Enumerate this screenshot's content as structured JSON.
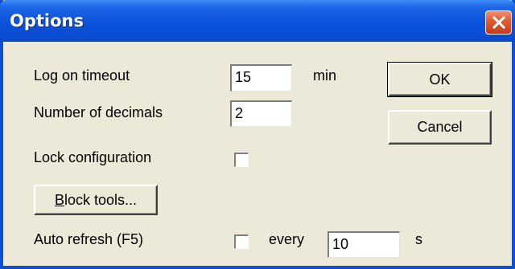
{
  "window": {
    "title": "Options"
  },
  "fields": {
    "log_on_timeout": {
      "label": "Log on timeout",
      "value": "15",
      "unit": "min"
    },
    "number_of_decimals": {
      "label": "Number of decimals",
      "value": "2"
    },
    "lock_configuration": {
      "label": "Lock configuration",
      "checked": false
    },
    "auto_refresh": {
      "label": "Auto refresh (F5)",
      "checked": false,
      "every_label": "every",
      "value": "10",
      "unit": "s"
    }
  },
  "buttons": {
    "ok": "OK",
    "cancel": "Cancel",
    "block_tools_mnemonic": "B",
    "block_tools_rest": "lock tools..."
  },
  "icons": {
    "close": "close-icon"
  },
  "colors": {
    "titlebar": "#0a52da",
    "close": "#e05a30",
    "face": "#ece9d8"
  }
}
